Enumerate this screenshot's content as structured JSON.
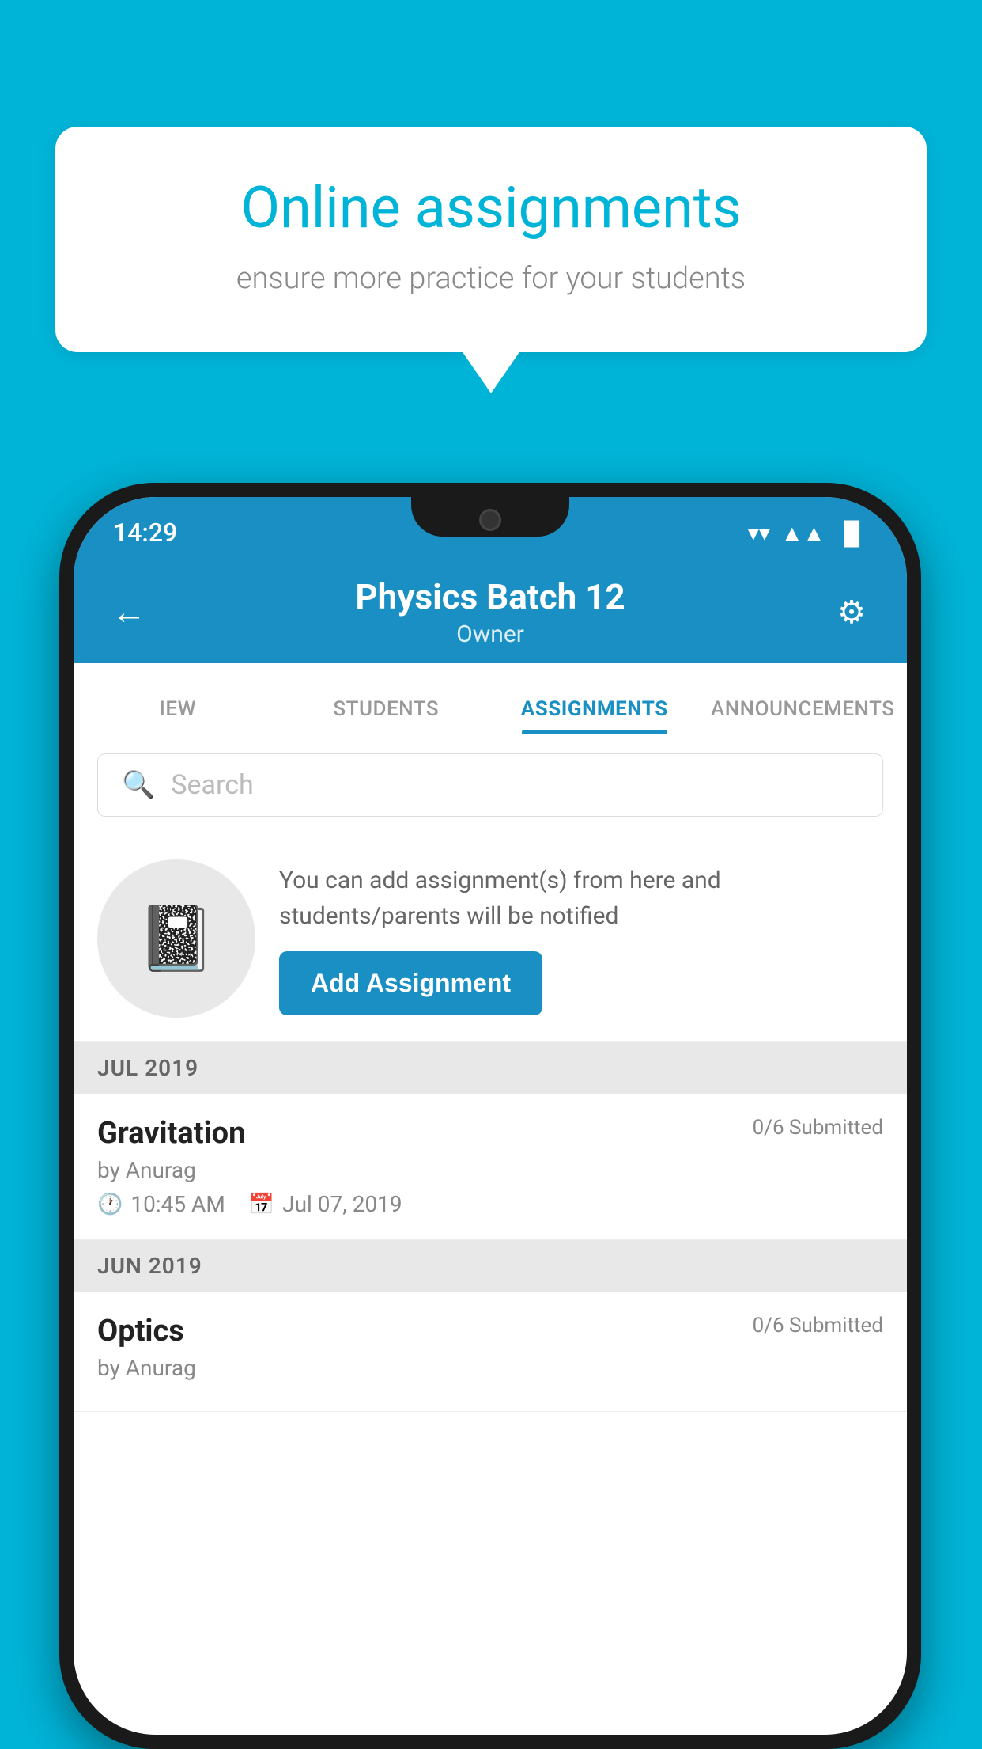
{
  "background_color": "#00b4d8",
  "speech_bubble": {
    "title": "Online assignments",
    "subtitle": "ensure more practice for your students"
  },
  "status_bar": {
    "time": "14:29",
    "wifi": "▼",
    "signal": "▲",
    "battery": "▐"
  },
  "header": {
    "title": "Physics Batch 12",
    "subtitle": "Owner",
    "back_label": "←",
    "settings_label": "⚙"
  },
  "tabs": [
    {
      "label": "IEW",
      "active": false
    },
    {
      "label": "STUDENTS",
      "active": false
    },
    {
      "label": "ASSIGNMENTS",
      "active": true
    },
    {
      "label": "ANNOUNCEMENTS",
      "active": false
    }
  ],
  "search": {
    "placeholder": "Search"
  },
  "promo": {
    "icon": "📓",
    "text": "You can add assignment(s) from here and students/parents will be notified",
    "button_label": "Add Assignment"
  },
  "sections": [
    {
      "label": "JUL 2019",
      "assignments": [
        {
          "name": "Gravitation",
          "submitted": "0/6 Submitted",
          "by": "by Anurag",
          "time": "10:45 AM",
          "date": "Jul 07, 2019"
        }
      ]
    },
    {
      "label": "JUN 2019",
      "assignments": [
        {
          "name": "Optics",
          "submitted": "0/6 Submitted",
          "by": "by Anurag",
          "time": "",
          "date": ""
        }
      ]
    }
  ]
}
